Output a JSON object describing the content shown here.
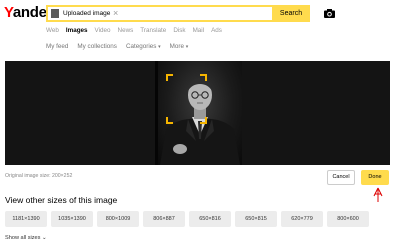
{
  "header": {
    "logo_first": "Y",
    "logo_rest": "andex",
    "search_field_text": "Uploaded image",
    "clear_glyph": "×",
    "search_button": "Search",
    "camera_icon": "camera-icon",
    "accent_color": "#ffdb4d",
    "logo_accent_color": "#ff0000"
  },
  "tabs": [
    {
      "label": "Web",
      "active": false
    },
    {
      "label": "Images",
      "active": true
    },
    {
      "label": "Video",
      "active": false
    },
    {
      "label": "News",
      "active": false
    },
    {
      "label": "Translate",
      "active": false
    },
    {
      "label": "Disk",
      "active": false
    },
    {
      "label": "Mail",
      "active": false
    },
    {
      "label": "Ads",
      "active": false
    }
  ],
  "subnav": {
    "my_feed": "My feed",
    "my_collections": "My collections",
    "categories": "Categories",
    "more": "More"
  },
  "viewer": {
    "crop_color": "#f5b400"
  },
  "controls": {
    "image_size_text": "Original image size: 200×252",
    "cancel": "Cancel",
    "done": "Done",
    "pointer_icon": "hand-drawn-arrow-icon"
  },
  "sizes": {
    "title": "View other sizes of this image",
    "items": [
      "1181×1390",
      "1035×1390",
      "800×1009",
      "806×887",
      "650×816",
      "650×815",
      "620×779",
      "800×600"
    ],
    "show_all": "Show all sizes"
  }
}
